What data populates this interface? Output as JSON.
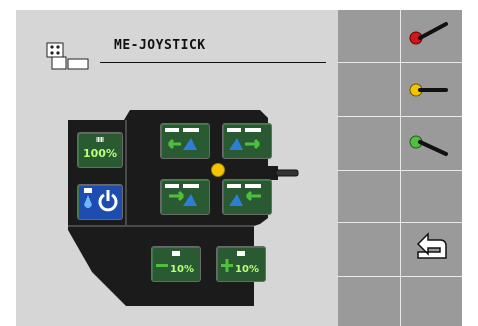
{
  "window": {
    "title": "ME-JOYSTICK"
  },
  "buttons": {
    "rate_100": "100%",
    "rate_minus": "10%",
    "rate_plus": "10%"
  },
  "colors": {
    "screen_bg": "#d6d6d6",
    "softkey_bg": "#9a9a9a",
    "panel_dark": "#1e1e1e",
    "button_green": "#2a5a32",
    "accent_blue": "#2e7dd6",
    "accent_green": "#4fbf3f",
    "center_yellow": "#f5c400"
  },
  "softkeys": [
    {
      "name": "joystick-red-icon",
      "color": "#d01818"
    },
    {
      "name": "joystick-yellow-icon",
      "color": "#f5c400"
    },
    {
      "name": "joystick-green-icon",
      "color": "#4fbf3f"
    },
    {
      "name": "empty"
    },
    {
      "name": "return-icon"
    },
    {
      "name": "empty"
    }
  ]
}
